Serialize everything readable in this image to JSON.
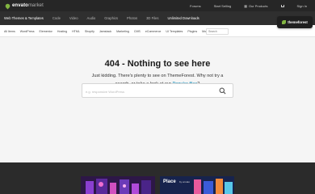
{
  "topbar": {
    "logo_brand": "envato",
    "logo_suffix": "market",
    "links": [
      "Forums",
      "Start Selling",
      "Our Products",
      "Sign In"
    ]
  },
  "categories": [
    {
      "label": "Web Themes & Templates",
      "active": true
    },
    {
      "label": "Code"
    },
    {
      "label": "Video"
    },
    {
      "label": "Audio"
    },
    {
      "label": "Graphics"
    },
    {
      "label": "Photos"
    },
    {
      "label": "3D Files"
    },
    {
      "label": "Unlimited Downloads"
    }
  ],
  "badge": {
    "label": "themeforest"
  },
  "subnav": {
    "items": [
      "All Items",
      "WordPress",
      "Elementor",
      "Hosting",
      "HTML",
      "Shopify",
      "Jamstack",
      "Marketing",
      "CMS",
      "eCommerce",
      "UI Templates",
      "Plugins",
      "More"
    ],
    "search_placeholder": "Search"
  },
  "main": {
    "title": "404 - Nothing to see here",
    "desc_line": "Just kidding. There's plenty to see on ThemeForest. Why not try a search, or take a look at our",
    "desc_link": "Popular files",
    "desc_end": "?",
    "search_placeholder": "e.g. responsive WordPress"
  },
  "footer": {
    "promo2_title": "Place",
    "promo2_sub": "by envato"
  },
  "colors": {
    "accent": "#82b541",
    "link": "#0084b4",
    "topbar": "#262626"
  }
}
